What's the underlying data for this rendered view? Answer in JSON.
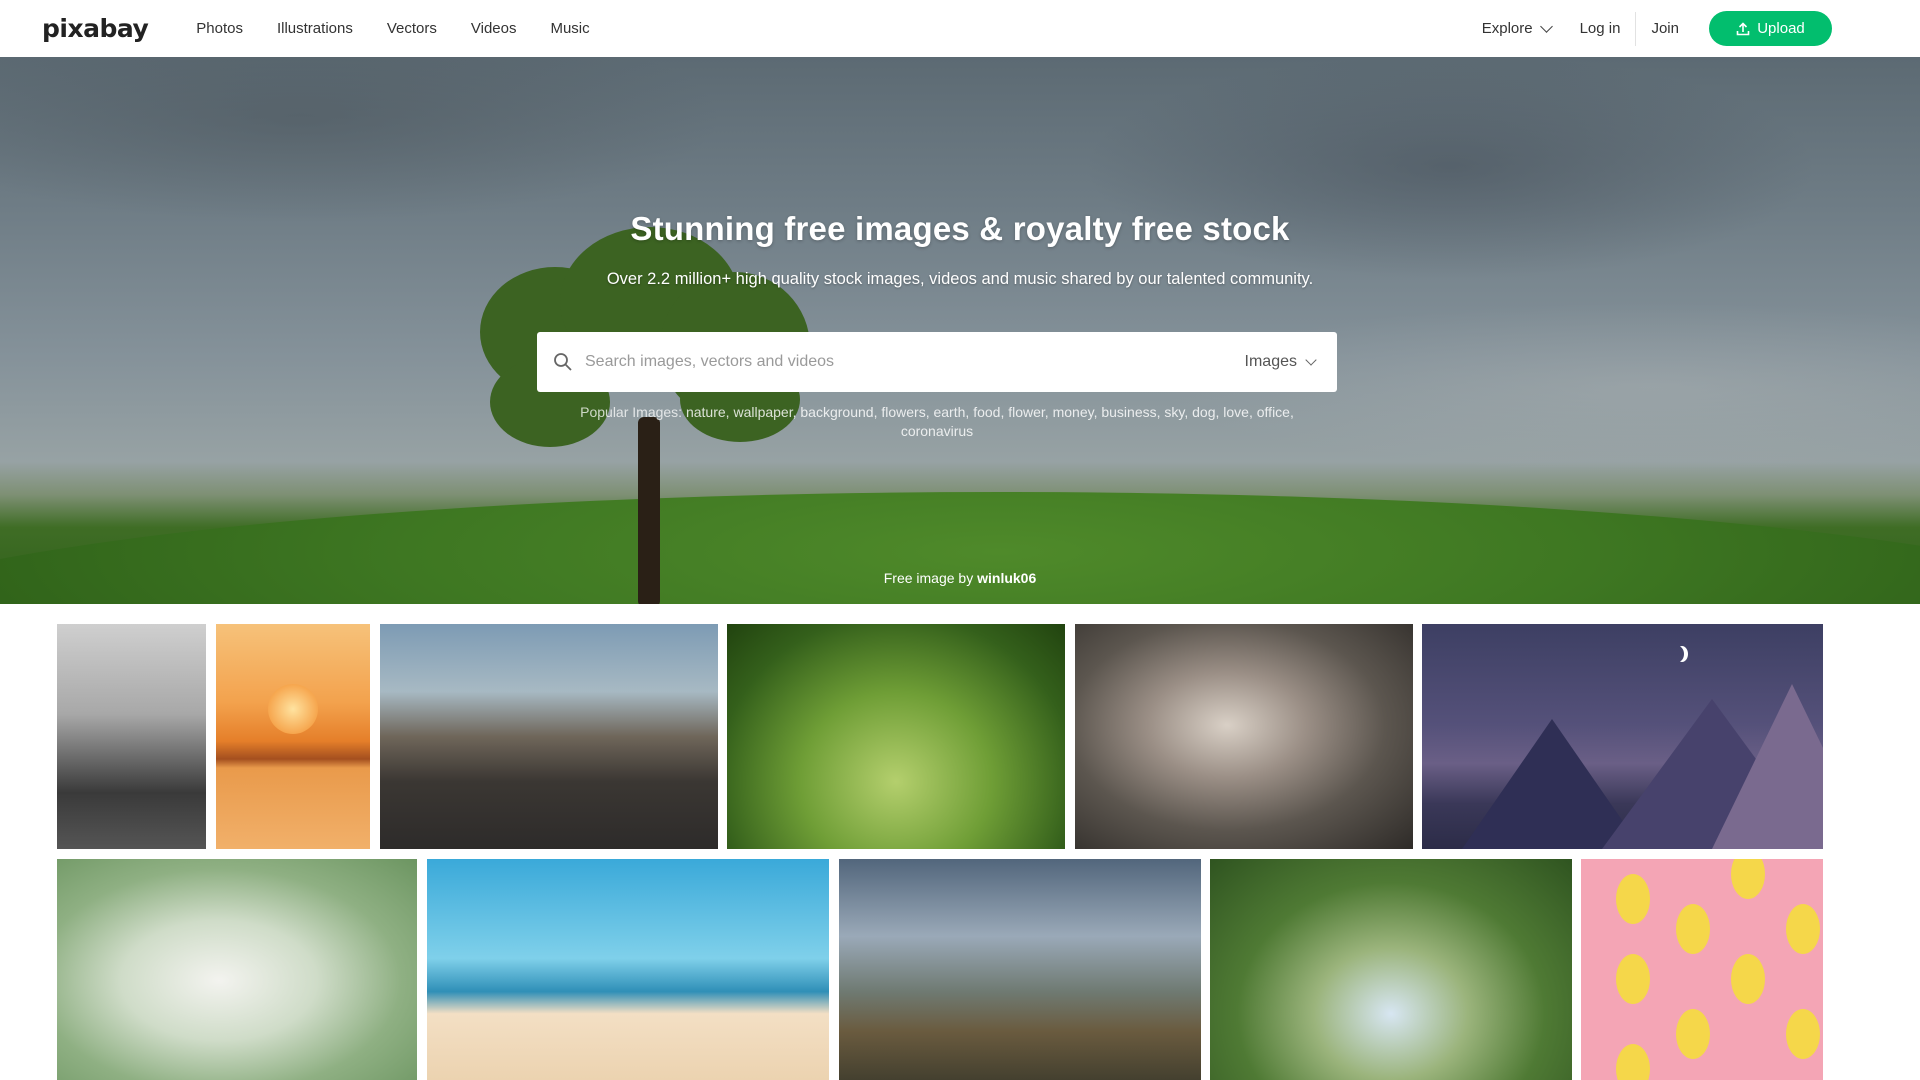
{
  "header": {
    "logo": "pixabay",
    "nav": [
      "Photos",
      "Illustrations",
      "Vectors",
      "Videos",
      "Music"
    ],
    "explore": "Explore",
    "login": "Log in",
    "join": "Join",
    "upload": "Upload",
    "accent_color": "#02be6e"
  },
  "hero": {
    "title": "Stunning free images & royalty free stock",
    "subtitle": "Over 2.2 million+ high quality stock images, videos and music shared by our talented community.",
    "search": {
      "placeholder": "Search images, vectors and videos",
      "value": "",
      "type": "Images"
    },
    "popular_label": "Popular Images:",
    "popular_tags": [
      "nature",
      "wallpaper",
      "background",
      "flowers",
      "earth",
      "food",
      "flower",
      "money",
      "business",
      "sky",
      "dog",
      "love",
      "office",
      "coronavirus"
    ],
    "credit_prefix": "Free image by",
    "credit_author": "winluk06"
  },
  "grid": {
    "rows": [
      [
        "woman-portrait-photo",
        "sunset-lake-photo",
        "canal-boats-photo",
        "daisies-grass-photo",
        "yorkshire-terrier-photo",
        "night-mountains-illustration"
      ],
      [
        "dandelion-seed-photo",
        "beach-loungers-photo",
        "mountain-landscape-photo",
        "orange-harvest-photo",
        "lemon-pattern-illustration"
      ]
    ]
  }
}
